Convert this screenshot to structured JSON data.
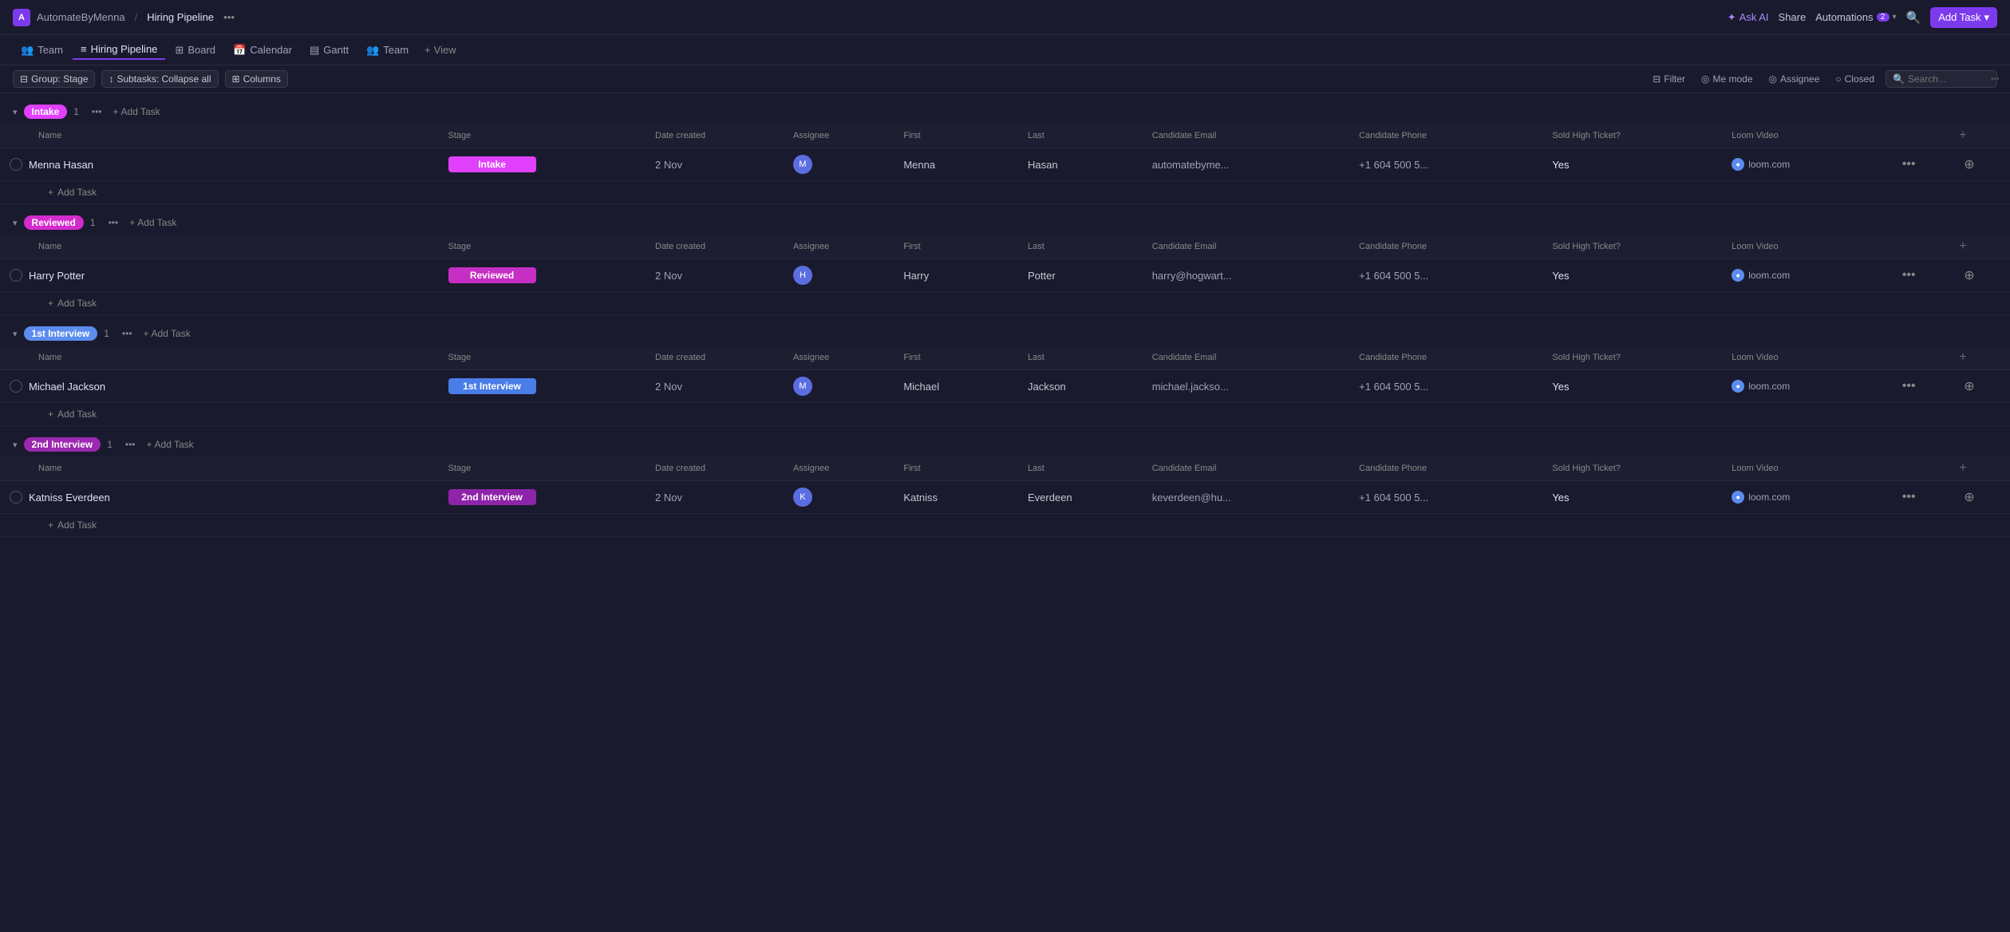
{
  "topbar": {
    "workspace_icon": "A",
    "workspace_name": "AutomateByMenna",
    "separator": "/",
    "pipeline_name": "Hiring Pipeline",
    "ai_label": "Ask AI",
    "share_label": "Share",
    "automations_label": "Automations",
    "automations_count": "2",
    "search_icon": "🔍",
    "add_task_label": "Add Task",
    "chevron": "▾"
  },
  "nav": {
    "tabs": [
      {
        "id": "team",
        "label": "Team",
        "icon": "👥",
        "active": false
      },
      {
        "id": "hiring-pipeline",
        "label": "Hiring Pipeline",
        "icon": "≡",
        "active": true
      },
      {
        "id": "board",
        "label": "Board",
        "icon": "⊞",
        "active": false
      },
      {
        "id": "calendar",
        "label": "Calendar",
        "icon": "📅",
        "active": false
      },
      {
        "id": "gantt",
        "label": "Gantt",
        "icon": "▤",
        "active": false
      },
      {
        "id": "team2",
        "label": "Team",
        "icon": "👥",
        "active": false
      }
    ],
    "add_view_label": "+ View"
  },
  "toolbar": {
    "group_label": "Group: Stage",
    "subtasks_label": "Subtasks: Collapse all",
    "columns_label": "Columns",
    "filter_label": "Filter",
    "memode_label": "Me mode",
    "assignee_label": "Assignee",
    "closed_label": "Closed",
    "search_placeholder": "Search..."
  },
  "columns": {
    "headers": [
      "Name",
      "Stage",
      "Date created",
      "Assignee",
      "First",
      "Last",
      "Candidate Email",
      "Candidate Phone",
      "Sold High Ticket?",
      "Loom Video",
      "",
      ""
    ]
  },
  "groups": [
    {
      "id": "intake",
      "label": "Intake",
      "badge_class": "badge-intake",
      "count": "1",
      "tasks": [
        {
          "id": "task-1",
          "name": "Menna Hasan",
          "stage": "Intake",
          "stage_class": "stage-intake",
          "date": "2 Nov",
          "assignee_initial": "M",
          "first": "Menna",
          "last": "Hasan",
          "email": "automatebyme...",
          "phone": "+1 604 500 5...",
          "sold": "Yes",
          "loom": "loom.com"
        }
      ]
    },
    {
      "id": "reviewed",
      "label": "Reviewed",
      "badge_class": "badge-reviewed",
      "count": "1",
      "tasks": [
        {
          "id": "task-2",
          "name": "Harry Potter",
          "stage": "Reviewed",
          "stage_class": "stage-reviewed",
          "date": "2 Nov",
          "assignee_initial": "H",
          "first": "Harry",
          "last": "Potter",
          "email": "harry@hogwart...",
          "phone": "+1 604 500 5...",
          "sold": "Yes",
          "loom": "loom.com"
        }
      ]
    },
    {
      "id": "1st-interview",
      "label": "1st Interview",
      "badge_class": "badge-1st-interview",
      "count": "1",
      "tasks": [
        {
          "id": "task-3",
          "name": "Michael Jackson",
          "stage": "1st Interview",
          "stage_class": "stage-1st-interview",
          "date": "2 Nov",
          "assignee_initial": "M",
          "first": "Michael",
          "last": "Jackson",
          "email": "michael.jackso...",
          "phone": "+1 604 500 5...",
          "sold": "Yes",
          "loom": "loom.com"
        }
      ]
    },
    {
      "id": "2nd-interview",
      "label": "2nd Interview",
      "badge_class": "badge-2nd-interview",
      "count": "1",
      "tasks": [
        {
          "id": "task-4",
          "name": "Katniss Everdeen",
          "stage": "2nd Interview",
          "stage_class": "stage-2nd-interview",
          "date": "2 Nov",
          "assignee_initial": "K",
          "first": "Katniss",
          "last": "Everdeen",
          "email": "keverdeen@hu...",
          "phone": "+1 604 500 5...",
          "sold": "Yes",
          "loom": "loom.com"
        }
      ]
    }
  ],
  "breadcrumb": {
    "workspace": "AutomateByMenna",
    "separator": "/",
    "page": "Hiring Pipeline"
  },
  "icons": {
    "star": "✦",
    "sparkle": "✦",
    "plus": "+",
    "chevron_right": "›",
    "chevron_down": "▾",
    "ellipsis": "•••",
    "search": "🔍",
    "filter": "⊞",
    "loom_dot": "●",
    "add_col": "+"
  }
}
